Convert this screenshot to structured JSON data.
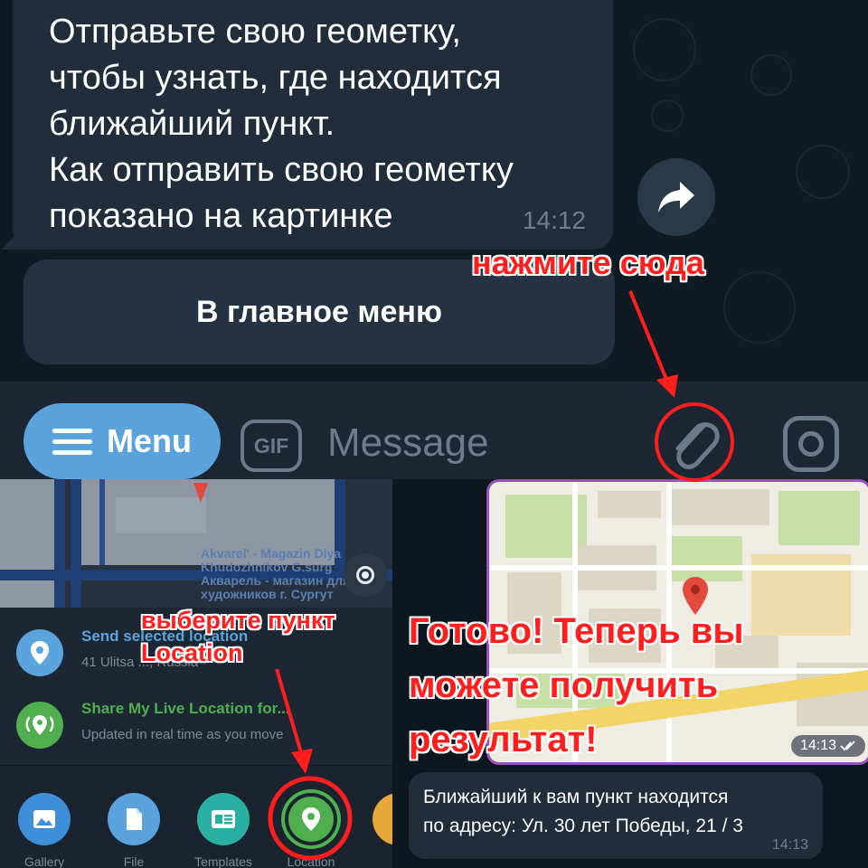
{
  "chat": {
    "message_lines": [
      "Отправьте свою геометку,",
      "чтобы узнать, где находится",
      "ближайший пункт.",
      "Как отправить свою геометку",
      "показано на картинке"
    ],
    "message_time": "14:12",
    "keyboard_button": "В главное меню"
  },
  "input_bar": {
    "menu_label": "Menu",
    "gif_label": "GIF",
    "message_placeholder": "Message",
    "icons": [
      "menu-icon",
      "gif-icon",
      "paperclip-icon",
      "camera-icon"
    ]
  },
  "location_panel": {
    "map_label_lines": [
      "Akvarel' - Magazin Dlya",
      "Khudozhnikov G.surg",
      "Акварель - магазин для",
      "художников г. Сургут"
    ],
    "send_selected": {
      "title": "Send selected location",
      "subtitle": "41 Ulitsa ..., Russia"
    },
    "share_live": {
      "title": "Share My Live Location for...",
      "subtitle": "Updated in real time as you move"
    },
    "attach_items": [
      {
        "label": "Gallery",
        "icon": "image-icon",
        "color": "#3d8fd8"
      },
      {
        "label": "File",
        "icon": "file-icon",
        "color": "#5aa3dd"
      },
      {
        "label": "Templates",
        "icon": "templates-icon",
        "color": "#2ab0a3"
      },
      {
        "label": "Location",
        "icon": "location-pin-icon",
        "color": "#4fae4e"
      }
    ]
  },
  "result_panel": {
    "map_time": "14:13",
    "reply_lines": [
      "Ближайший к вам пункт находится",
      "по адресу: Ул. 30 лет Победы, 21 / 3"
    ],
    "reply_time": "14:13"
  },
  "annotations": {
    "tap_here": "нажмите сюда",
    "choose_location": [
      "выберите пункт",
      "Location"
    ],
    "done": [
      "Готово! Теперь вы",
      "можете получить",
      "результат!"
    ]
  },
  "colors": {
    "accent_blue": "#5aa3dd",
    "annotation_red": "#ff1e1e",
    "share_green": "#4fae4e",
    "bubble": "#212d3b"
  }
}
